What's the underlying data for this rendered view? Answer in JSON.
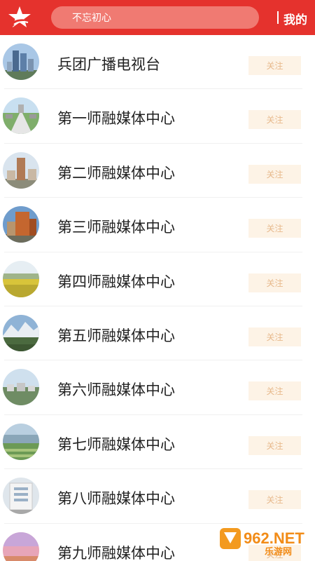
{
  "header": {
    "search_placeholder": "不忘初心",
    "mine_label": "我的",
    "logo_icon": "red-star-logo-icon",
    "brand_color": "#e5322d"
  },
  "channels": [
    {
      "name": "兵团广播电视台",
      "follow_label": "关注",
      "thumb": "city-skyline"
    },
    {
      "name": "第一师融媒体中心",
      "follow_label": "关注",
      "thumb": "plaza-aerial"
    },
    {
      "name": "第二师融媒体中心",
      "follow_label": "关注",
      "thumb": "tower-building"
    },
    {
      "name": "第三师融媒体中心",
      "follow_label": "关注",
      "thumb": "hotel-building"
    },
    {
      "name": "第四师融媒体中心",
      "follow_label": "关注",
      "thumb": "rapeseed-field"
    },
    {
      "name": "第五师融媒体中心",
      "follow_label": "关注",
      "thumb": "snow-mountains"
    },
    {
      "name": "第六师融媒体中心",
      "follow_label": "关注",
      "thumb": "town-aerial"
    },
    {
      "name": "第七师融媒体中心",
      "follow_label": "关注",
      "thumb": "farmland-aerial"
    },
    {
      "name": "第八师融媒体中心",
      "follow_label": "关注",
      "thumb": "white-building"
    },
    {
      "name": "第九师融媒体中心",
      "follow_label": "关注",
      "thumb": "sunset-sky"
    }
  ],
  "watermark": {
    "brand_text": "962.NET",
    "sub_text": "乐游网"
  }
}
